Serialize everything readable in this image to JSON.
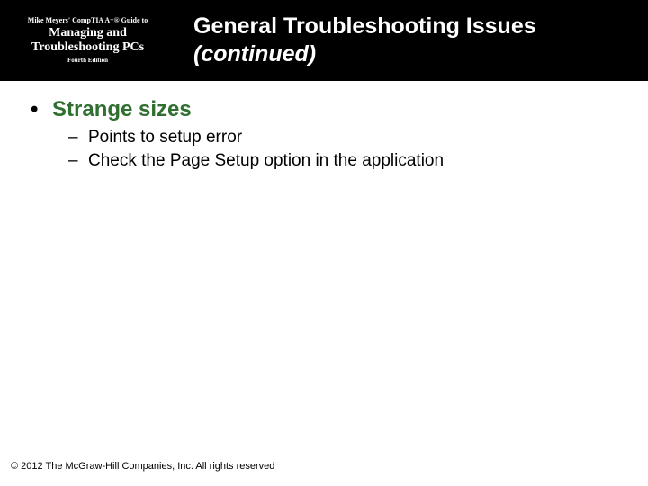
{
  "header": {
    "book": {
      "line1": "Mike Meyers' CompTIA A+® Guide to",
      "line2": "Managing and Troubleshooting PCs",
      "line3": "Fourth Edition"
    },
    "title_main": "General Troubleshooting Issues",
    "title_cont": "(continued)"
  },
  "body": {
    "bullets": [
      {
        "text": "Strange sizes",
        "sub": [
          "Points to setup error",
          "Check the Page Setup option in the application"
        ]
      }
    ]
  },
  "footer": "© 2012 The McGraw-Hill Companies, Inc. All rights reserved"
}
